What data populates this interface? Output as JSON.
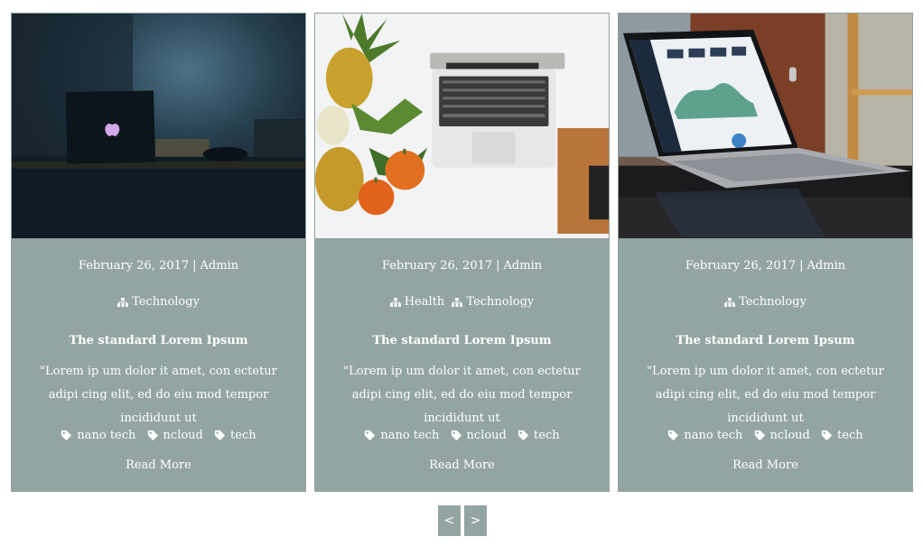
{
  "posts": [
    {
      "image": "dark-desk-laptop-photo",
      "date": "February 26, 2017",
      "author": "Admin",
      "categories": [
        "Technology"
      ],
      "title": "The standard Lorem Ipsum",
      "excerpt": "\"Lorem ip um dolor it amet, con ectetur adipi cing elit, ed do eiu mod tempor incididunt ut",
      "tags": [
        "nano tech",
        "ncloud",
        "tech"
      ],
      "read_more": "Read More"
    },
    {
      "image": "laptop-pineapples-photo",
      "date": "February 26, 2017",
      "author": "Admin",
      "categories": [
        "Health",
        "Technology"
      ],
      "title": "The standard Lorem Ipsum",
      "excerpt": "\"Lorem ip um dolor it amet, con ectetur adipi cing elit, ed do eiu mod tempor incididunt ut",
      "tags": [
        "nano tech",
        "ncloud",
        "tech"
      ],
      "read_more": "Read More"
    },
    {
      "image": "laptop-dashboard-photo",
      "date": "February 26, 2017",
      "author": "Admin",
      "categories": [
        "Technology"
      ],
      "title": "The standard Lorem Ipsum",
      "excerpt": "\"Lorem ip um dolor it amet, con ectetur adipi cing elit, ed do eiu mod tempor incididunt ut",
      "tags": [
        "nano tech",
        "ncloud",
        "tech"
      ],
      "read_more": "Read More"
    }
  ],
  "separator": "|",
  "pager": {
    "prev": "<",
    "next": ">"
  },
  "colors": {
    "card_bg": "#93a5a3",
    "text": "#ffffff"
  }
}
